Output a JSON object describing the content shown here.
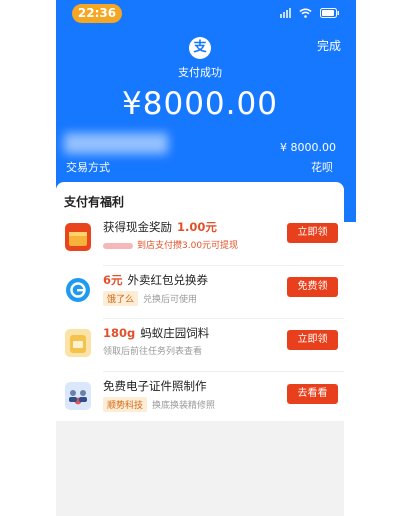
{
  "status_bar": {
    "time": "22:36"
  },
  "header": {
    "done_label": "完成",
    "logo_glyph": "支",
    "status": "支付成功",
    "amount": "¥8000.00",
    "pay_amount": "¥ 8000.00",
    "method_label": "交易方式",
    "method_value": "花呗"
  },
  "benefits": {
    "title": "支付有福利",
    "items": [
      {
        "icon": "red-envelope-icon",
        "highlight": "",
        "title": "获得现金奖励",
        "title_after": "1.00元",
        "tag": "",
        "subtitle": "到店支付攒3.00元可提现",
        "button": "立即领"
      },
      {
        "icon": "eleme-icon",
        "highlight": "6元",
        "title": "外卖红包兑换券",
        "title_after": "",
        "tag": "饿了么",
        "subtitle": "兑换后可使用",
        "button": "免费领"
      },
      {
        "icon": "feed-bag-icon",
        "highlight": "180g",
        "title": "蚂蚁庄园饲料",
        "title_after": "",
        "tag": "",
        "subtitle": "领取后前往任务列表查看",
        "button": "立即领"
      },
      {
        "icon": "id-photo-icon",
        "highlight": "",
        "title": "免费电子证件照制作",
        "title_after": "",
        "tag": "顺势科技",
        "subtitle": "换底换装精修照",
        "button": "去看看"
      }
    ]
  },
  "colors": {
    "header_blue": "#1677ff",
    "time_pill": "#f5a623",
    "button_red": "#e8401c",
    "highlight_red": "#e2502a"
  }
}
